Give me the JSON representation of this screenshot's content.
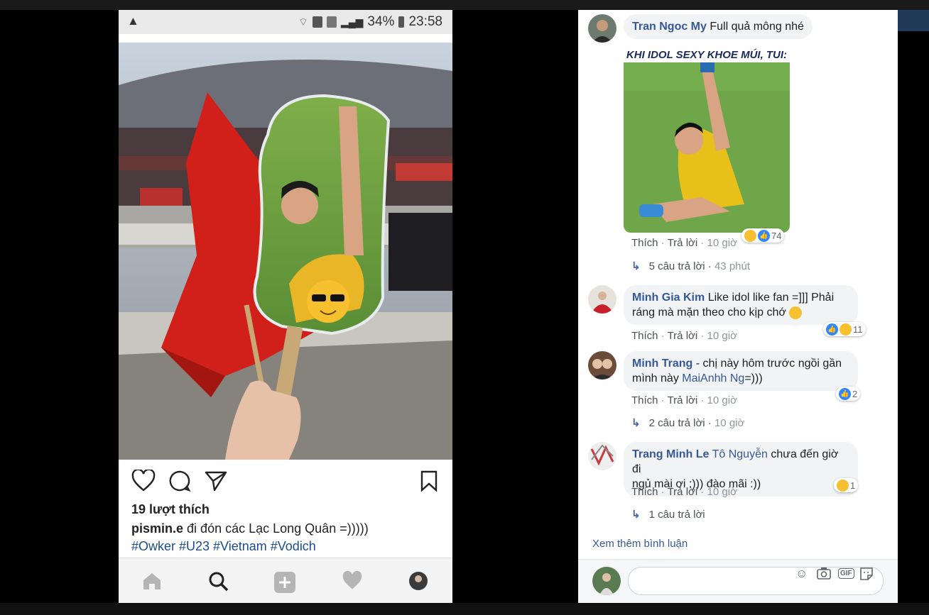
{
  "status_bar": {
    "battery": "34%",
    "time": "23:58"
  },
  "instagram": {
    "likes": "19 lượt thích",
    "username": "pismin.e",
    "caption": "đi đón các Lạc Long Quân =)))))",
    "hashtags": "#Owker #U23 #Vietnam #Vodich",
    "icons": [
      "heart-icon",
      "comment-icon",
      "share-icon",
      "bookmark-icon"
    ],
    "tabbar": [
      "home-icon",
      "search-icon",
      "add-icon",
      "activity-icon",
      "profile-icon"
    ]
  },
  "facebook": {
    "comments": [
      {
        "name": "Tran Ngoc My",
        "text": "Full quả mông nhé",
        "image_caption": "KHI IDOL SEXY KHOE MÚI, TUI:",
        "like": "Thích",
        "reply": "Trả lời",
        "time": "10 giờ",
        "reaction_count": "74",
        "replies": "5 câu trả lời",
        "replies_time": "43 phút"
      },
      {
        "name": "Minh Gia Kim",
        "text": "Like idol like fan =]]] Phải",
        "text2": "ráng mà mặn theo cho kịp chớ",
        "like": "Thích",
        "reply": "Trả lời",
        "time": "10 giờ",
        "reaction_count": "11"
      },
      {
        "name": "Minh Trang",
        "text": "- chị này hôm trước ngồi gần",
        "text2_pre": "mình này",
        "mention": "MaiAnhh Ng",
        "text2_post": "=)))",
        "like": "Thích",
        "reply": "Trả lời",
        "time": "10 giờ",
        "reaction_count": "2",
        "replies": "2 câu trả lời",
        "replies_time": "10 giờ"
      },
      {
        "name": "Trang Minh Le",
        "mention": "Tô Nguyễn",
        "text": "chưa đến giờ đi",
        "text2": "ngủ mài ơi :))) đào mãi :))",
        "like": "Thích",
        "reply": "Trả lời",
        "time": "10 giờ",
        "reaction_count": "1",
        "replies": "1 câu trả lời"
      }
    ],
    "more_comments": "Xem thêm bình luận",
    "composer_icons": [
      "emoji-icon",
      "camera-icon",
      "gif-icon",
      "sticker-icon"
    ],
    "gif_label": "GIF"
  },
  "colors": {
    "fb_link": "#365899",
    "ig_hashtag": "#1a4c8f",
    "like_blue": "#2d88ff",
    "haha_yellow": "#f7c02e"
  }
}
